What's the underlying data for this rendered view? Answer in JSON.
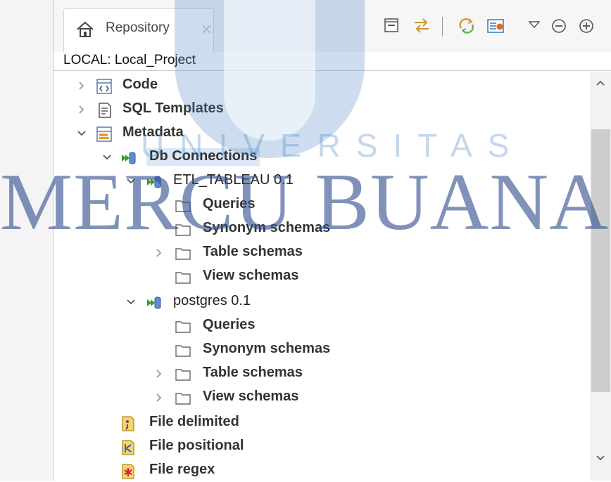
{
  "view": {
    "tab_label": "Repository",
    "tab_close": "×",
    "project_label": "LOCAL: Local_Project"
  },
  "toolbar": {
    "icons": [
      "collapse-all-icon",
      "link-with-editor-icon",
      "refresh-icon",
      "filter-icon",
      "view-menu-icon",
      "minimize-icon",
      "maximize-icon"
    ]
  },
  "tree": {
    "code": "Code",
    "sql_templates": "SQL Templates",
    "metadata": "Metadata",
    "db_connections": "Db Connections",
    "etl": {
      "label": "ETL_TABLEAU 0.1",
      "queries": "Queries",
      "synonym_schemas": "Synonym schemas",
      "table_schemas": "Table schemas",
      "view_schemas": "View schemas"
    },
    "postgres": {
      "label": "postgres 0.1",
      "queries": "Queries",
      "synonym_schemas": "Synonym schemas",
      "table_schemas": "Table schemas",
      "view_schemas": "View schemas"
    },
    "file_delimited": "File delimited",
    "file_positional": "File positional",
    "file_regex": "File regex"
  },
  "watermark": {
    "line1": "UNIVERSITAS",
    "line2": "MERCU BUANA"
  },
  "colors": {
    "selection": "#dbe8f8",
    "watermark_blue": "#34508f",
    "db_icon_green": "#3a9a2a",
    "folder_outline": "#6a6a6a"
  }
}
